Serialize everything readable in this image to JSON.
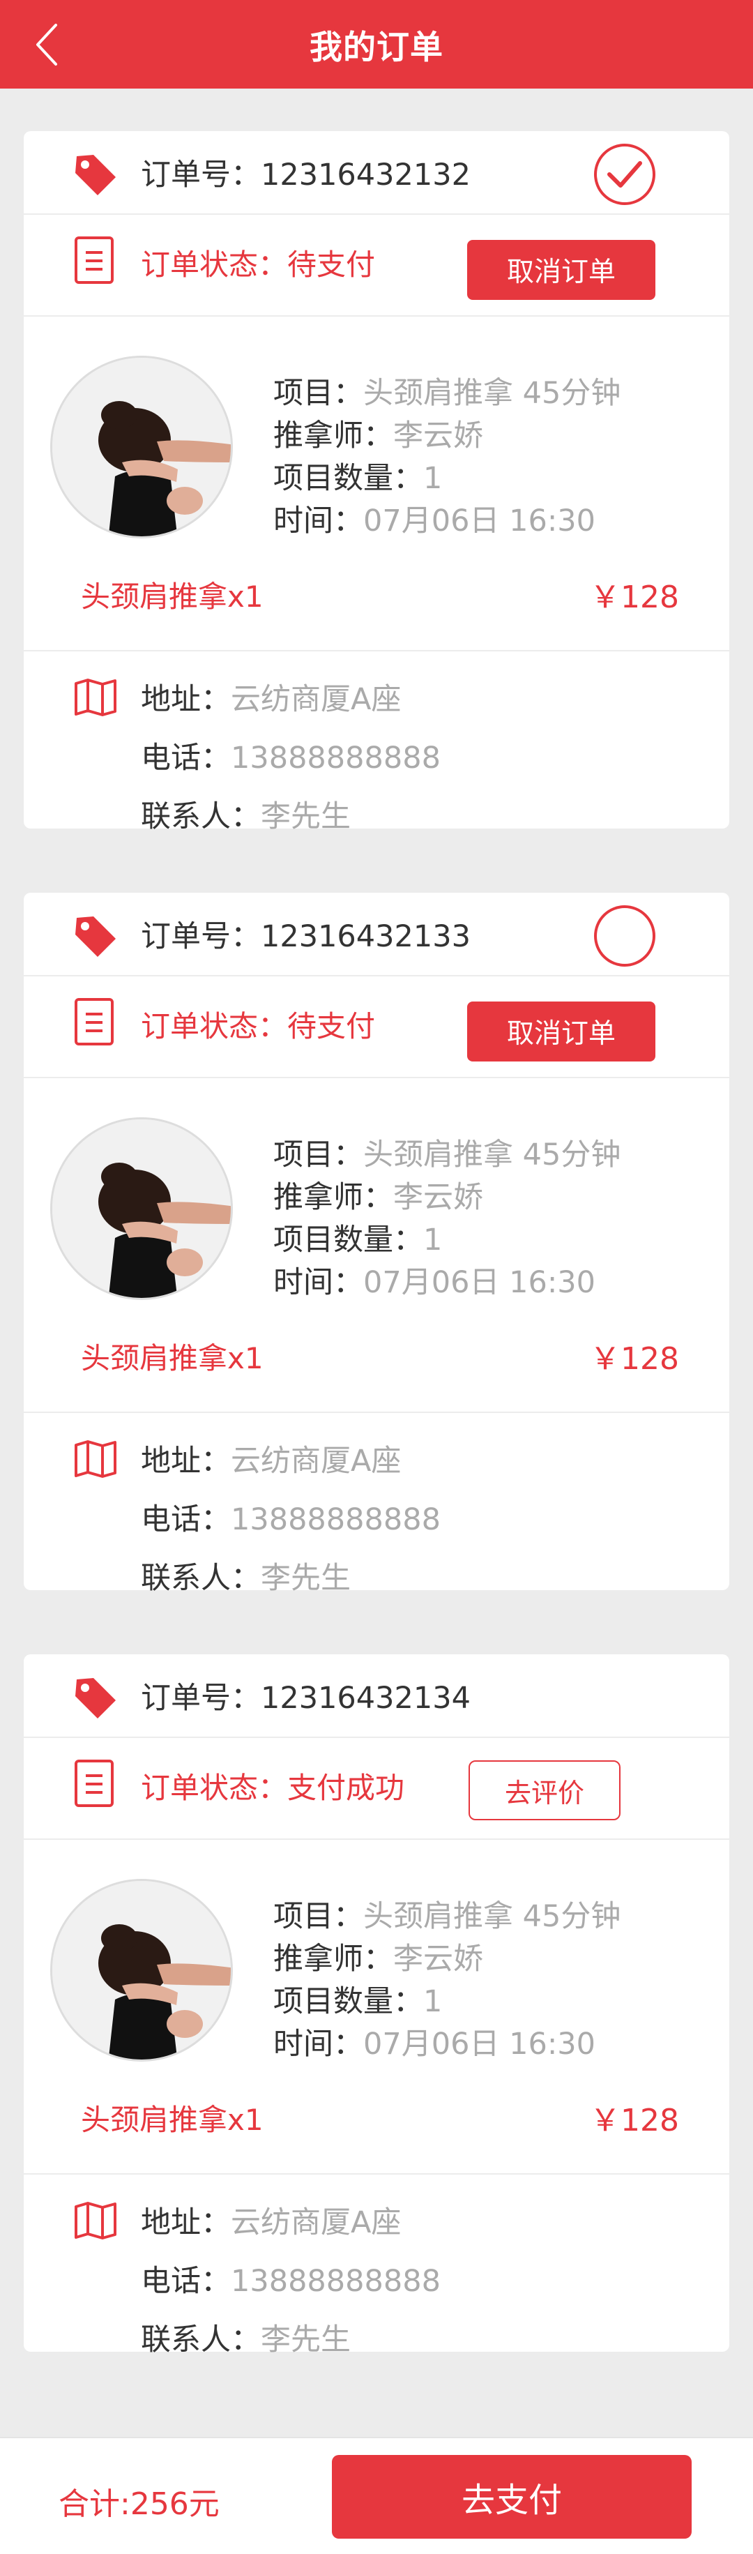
{
  "header": {
    "title": "我的订单"
  },
  "colors": {
    "accent": "#e6373e",
    "muted": "#aaaaaa",
    "text": "#333333",
    "bg": "#ececec"
  },
  "orders": [
    {
      "order_label": "订单号：12316432132",
      "selected": true,
      "status": "订单状态：待支付",
      "action_label": "取消订单",
      "action_type": "cancel",
      "project_key": "项目：",
      "project_val": "头颈肩推拿  45分钟",
      "therapist_key": "推拿师：",
      "therapist_val": "李云娇",
      "qty_key": "项目数量：",
      "qty_val": "1",
      "time_key": "时间：",
      "time_val": "07月06日  16:30",
      "summary": "头颈肩推拿x1",
      "price": "￥128",
      "addr_key": "地址：",
      "addr_val": "云纺商厦A座",
      "phone_key": "电话：",
      "phone_val": "13888888888",
      "contact_key": "联系人：",
      "contact_val": "李先生"
    },
    {
      "order_label": "订单号：12316432133",
      "selected": false,
      "status": "订单状态：待支付",
      "action_label": "取消订单",
      "action_type": "cancel",
      "project_key": "项目：",
      "project_val": "头颈肩推拿  45分钟",
      "therapist_key": "推拿师：",
      "therapist_val": "李云娇",
      "qty_key": "项目数量：",
      "qty_val": "1",
      "time_key": "时间：",
      "time_val": "07月06日  16:30",
      "summary": "头颈肩推拿x1",
      "price": "￥128",
      "addr_key": "地址：",
      "addr_val": "云纺商厦A座",
      "phone_key": "电话：",
      "phone_val": "13888888888",
      "contact_key": "联系人：",
      "contact_val": "李先生"
    },
    {
      "order_label": "订单号：12316432134",
      "selected": null,
      "status": "订单状态：支付成功",
      "action_label": "去评价",
      "action_type": "review",
      "project_key": "项目：",
      "project_val": "头颈肩推拿  45分钟",
      "therapist_key": "推拿师：",
      "therapist_val": "李云娇",
      "qty_key": "项目数量：",
      "qty_val": "1",
      "time_key": "时间：",
      "time_val": "07月06日  16:30",
      "summary": "头颈肩推拿x1",
      "price": "￥128",
      "addr_key": "地址：",
      "addr_val": "云纺商厦A座",
      "phone_key": "电话：",
      "phone_val": "13888888888",
      "contact_key": "联系人：",
      "contact_val": "李先生"
    }
  ],
  "footer": {
    "total": "合计:256元",
    "pay_label": "去支付"
  }
}
